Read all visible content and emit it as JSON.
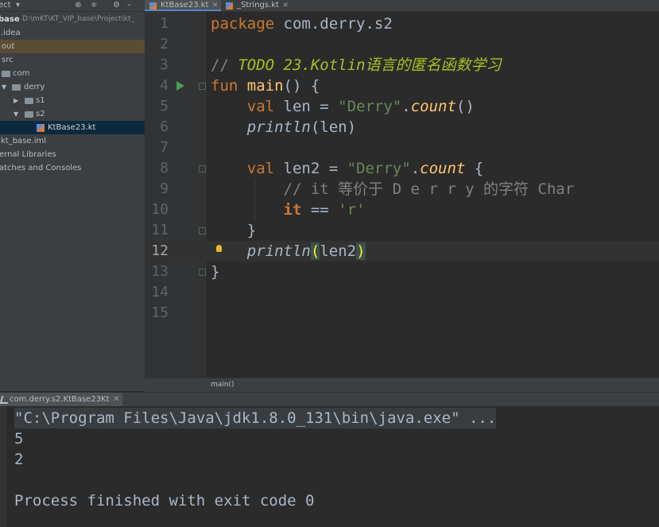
{
  "project_panel": {
    "header_title": "ect",
    "tree": [
      {
        "label": "base",
        "hint": "D:\\mKT\\KT_VIP_base\\Project\\kt_"
      },
      {
        "label": ".idea"
      },
      {
        "label": "out"
      },
      {
        "label": "src"
      },
      {
        "label": "com"
      },
      {
        "label": "derry"
      },
      {
        "label": "s1"
      },
      {
        "label": "s2"
      },
      {
        "label": "KtBase23.kt"
      },
      {
        "label": "kt_base.iml"
      },
      {
        "label": "ernal Libraries"
      },
      {
        "label": "atches and Consoles"
      }
    ]
  },
  "tabs": [
    {
      "label": "KtBase23.kt",
      "active": true
    },
    {
      "label": "_Strings.kt",
      "active": false
    }
  ],
  "editor": {
    "line_numbers": [
      "1",
      "2",
      "3",
      "4",
      "5",
      "6",
      "7",
      "8",
      "9",
      "10",
      "11",
      "12",
      "13",
      "14",
      "15"
    ],
    "current_line": "12",
    "code": {
      "l1_kw": "package",
      "l1_rest": " com.derry.s2",
      "l3_slash": "// ",
      "l3_todo": "TODO 23.Kotlin语言的匿名函数学习",
      "l4_kw": "fun",
      "l4_fn": "main",
      "l4_rest": "() {",
      "l5_kw": "val",
      "l5_a": " len = ",
      "l5_str": "\"Derry\"",
      "l5_dot": ".",
      "l5_ext": "count",
      "l5_end": "()",
      "l6_std": "println",
      "l6_rest": "(len)",
      "l8_kw": "val",
      "l8_a": " len2 = ",
      "l8_str": "\"Derry\"",
      "l8_dot": ".",
      "l8_ext": "count",
      "l8_end": " {",
      "l9_cmt": "// it 等价于 D e r r y 的字符 Char",
      "l10_it": "it",
      "l10_a": " == ",
      "l10_str": "'r'",
      "l11": "}",
      "l12_std": "println",
      "l12_open": "(",
      "l12_mid": "len2",
      "l12_close": ")",
      "l13": "}"
    },
    "breadcrumb": "main()"
  },
  "run_panel": {
    "tab_label": "com.derry.s2.KtBase23Kt",
    "output": [
      "\"C:\\Program Files\\Java\\jdk1.8.0_131\\bin\\java.exe\" ...",
      "5",
      "2",
      "",
      "Process finished with exit code 0"
    ]
  },
  "colors": {
    "keyword": "#cc7832",
    "string": "#6a8759",
    "function": "#ffc66d",
    "todo": "#a8c023",
    "comment": "#808080",
    "background": "#2b2b2b"
  }
}
